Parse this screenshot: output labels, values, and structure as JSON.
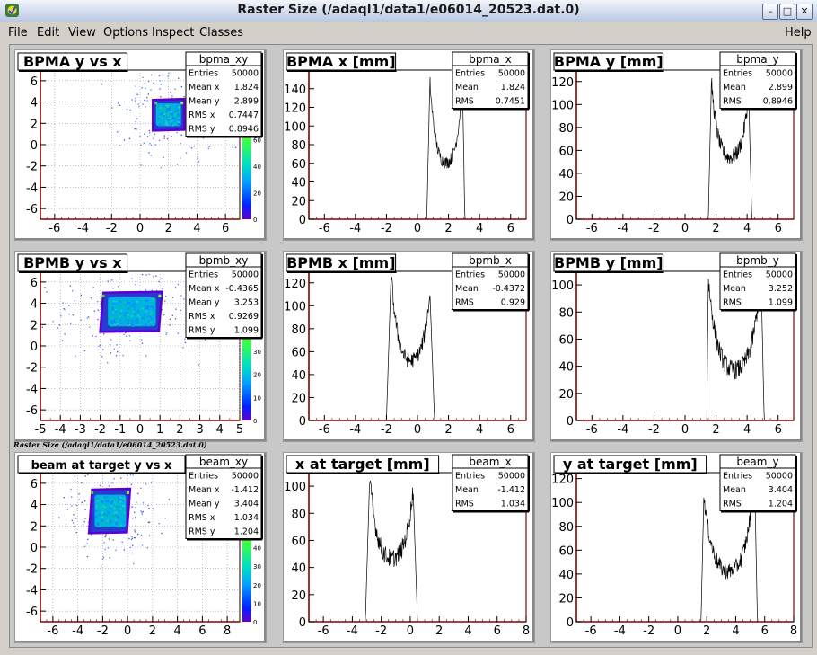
{
  "window": {
    "title": "Raster Size (/adaql1/data1/e06014_20523.dat.0)"
  },
  "menu": {
    "items": [
      "File",
      "Edit",
      "View",
      "Options",
      "Inspect",
      "Classes"
    ],
    "help": "Help"
  },
  "canvas_note": "Raster Size (/adaql1/data1/e06014_20523.dat.0)",
  "colors": {
    "titlebar": "#c3d0e8",
    "axis": "#8b0000",
    "line": "#000000",
    "background": "#d4d0c8"
  },
  "chart_data": [
    {
      "type": "heatmap",
      "title": "BPMA y vs x",
      "stats_name": "bpma_xy",
      "stats": [
        [
          "Entries",
          "50000"
        ],
        [
          "Mean x",
          "1.824"
        ],
        [
          "Mean y",
          "2.899"
        ],
        [
          "RMS x",
          "0.7447"
        ],
        [
          "RMS y",
          "0.8946"
        ]
      ],
      "xlim": [
        -7,
        7
      ],
      "ylim": [
        -7,
        7
      ],
      "xticks": [
        -6,
        -4,
        -2,
        0,
        2,
        4,
        6
      ],
      "yticks": [
        -6,
        -4,
        -2,
        0,
        2,
        4,
        6
      ],
      "core": {
        "x0": 0.9,
        "x1": 3.1,
        "y0": 1.4,
        "y1": 4.2,
        "skew": 0
      },
      "palette_ticks": [
        0,
        20,
        40,
        60
      ],
      "palette_max": 70
    },
    {
      "type": "line",
      "title": "BPMA x [mm]",
      "stats_name": "bpma_x",
      "stats": [
        [
          "Entries",
          "50000"
        ],
        [
          "Mean",
          "1.824"
        ],
        [
          "RMS",
          "0.7451"
        ]
      ],
      "xlim": [
        -7,
        7
      ],
      "ylim": [
        0,
        160
      ],
      "xticks": [
        -6,
        -4,
        -2,
        0,
        2,
        4,
        6
      ],
      "yticks": [
        0,
        20,
        40,
        60,
        80,
        100,
        120,
        140
      ],
      "shape": {
        "left": 0.8,
        "right": 2.9,
        "peakL": 148,
        "peakR": 148,
        "mid": 58,
        "leftStart": 0.6,
        "rightEnd": 3.05
      }
    },
    {
      "type": "line",
      "title": "BPMA y [mm]",
      "stats_name": "bpma_y",
      "stats": [
        [
          "Entries",
          "50000"
        ],
        [
          "Mean",
          "2.899"
        ],
        [
          "RMS",
          "0.8946"
        ]
      ],
      "xlim": [
        -7,
        7
      ],
      "ylim": [
        0,
        130
      ],
      "xticks": [
        -6,
        -4,
        -2,
        0,
        2,
        4,
        6
      ],
      "yticks": [
        0,
        20,
        40,
        60,
        80,
        100,
        120
      ],
      "shape": {
        "left": 1.7,
        "right": 4.1,
        "peakL": 120,
        "peakR": 110,
        "mid": 52,
        "leftStart": 1.5,
        "rightEnd": 4.3
      }
    },
    {
      "type": "heatmap",
      "title": "BPMB y vs x",
      "stats_name": "bpmb_xy",
      "stats": [
        [
          "Entries",
          "50000"
        ],
        [
          "Mean x",
          "-0.4365"
        ],
        [
          "Mean y",
          "3.253"
        ],
        [
          "RMS x",
          "0.9269"
        ],
        [
          "RMS y",
          "1.099"
        ]
      ],
      "xlim": [
        -5,
        5
      ],
      "ylim": [
        -7,
        7
      ],
      "xticks": [
        -5,
        -4,
        -3,
        -2,
        -1,
        0,
        1,
        2,
        3,
        4,
        5
      ],
      "yticks": [
        -6,
        -4,
        -2,
        0,
        2,
        4,
        6
      ],
      "core": {
        "x0": -2.0,
        "x1": 1.1,
        "y0": 1.4,
        "y1": 5.0,
        "skew": 0.35
      },
      "palette_ticks": [
        0,
        10,
        20,
        30
      ],
      "palette_max": 40
    },
    {
      "type": "line",
      "title": "BPMB x [mm]",
      "stats_name": "bpmb_x",
      "stats": [
        [
          "Entries",
          "50000"
        ],
        [
          "Mean",
          "-0.4372"
        ],
        [
          "RMS",
          "0.929"
        ]
      ],
      "xlim": [
        -7,
        7
      ],
      "ylim": [
        0,
        130
      ],
      "xticks": [
        -6,
        -4,
        -2,
        0,
        2,
        4,
        6
      ],
      "yticks": [
        0,
        20,
        40,
        60,
        80,
        100,
        120
      ],
      "shape": {
        "left": -1.7,
        "right": 0.8,
        "peakL": 128,
        "peakR": 112,
        "mid": 50,
        "leftStart": -2.0,
        "rightEnd": 1.1
      }
    },
    {
      "type": "line",
      "title": "BPMB y [mm]",
      "stats_name": "bpmb_y",
      "stats": [
        [
          "Entries",
          "50000"
        ],
        [
          "Mean",
          "3.252"
        ],
        [
          "RMS",
          "1.099"
        ]
      ],
      "xlim": [
        -7,
        7
      ],
      "ylim": [
        0,
        110
      ],
      "xticks": [
        -6,
        -4,
        -2,
        0,
        2,
        4,
        6
      ],
      "yticks": [
        0,
        20,
        40,
        60,
        80,
        100
      ],
      "shape": {
        "left": 1.5,
        "right": 4.9,
        "peakL": 104,
        "peakR": 108,
        "mid": 35,
        "leftStart": 1.4,
        "rightEnd": 5.1
      }
    },
    {
      "type": "heatmap",
      "title": "beam at target y vs x",
      "stats_name": "beam_xy",
      "stats": [
        [
          "Entries",
          "50000"
        ],
        [
          "Mean x",
          "-1.412"
        ],
        [
          "Mean y",
          "3.404"
        ],
        [
          "RMS x",
          "1.034"
        ],
        [
          "RMS y",
          "1.204"
        ]
      ],
      "xlim": [
        -7,
        9
      ],
      "ylim": [
        -7,
        7
      ],
      "xticks": [
        -6,
        -4,
        -2,
        0,
        2,
        4,
        6,
        8
      ],
      "yticks": [
        -6,
        -4,
        -2,
        0,
        2,
        4,
        6
      ],
      "core": {
        "x0": -3.1,
        "x1": 0.2,
        "y0": 1.4,
        "y1": 5.4,
        "skew": 0.35
      },
      "palette_ticks": [
        0,
        10,
        20,
        30,
        40
      ],
      "palette_max": 50
    },
    {
      "type": "line",
      "title": "x at target [mm]",
      "stats_name": "beam_x",
      "stats": [
        [
          "Entries",
          "50000"
        ],
        [
          "Mean",
          "-1.412"
        ],
        [
          "RMS",
          "1.034"
        ]
      ],
      "xlim": [
        -7,
        8
      ],
      "ylim": [
        0,
        110
      ],
      "xticks": [
        -6,
        -4,
        -2,
        0,
        2,
        4,
        6,
        8
      ],
      "yticks": [
        0,
        20,
        40,
        60,
        80,
        100
      ],
      "shape": {
        "left": -2.8,
        "right": 0.2,
        "peakL": 106,
        "peakR": 98,
        "mid": 45,
        "leftStart": -3.1,
        "rightEnd": 0.5
      }
    },
    {
      "type": "line",
      "title": "y at target [mm]",
      "stats_name": "beam_y",
      "stats": [
        [
          "Entries",
          "50000"
        ],
        [
          "Mean",
          "3.404"
        ],
        [
          "RMS",
          "1.204"
        ]
      ],
      "xlim": [
        -7,
        8
      ],
      "ylim": [
        0,
        125
      ],
      "xticks": [
        -6,
        -4,
        -2,
        0,
        2,
        4,
        6,
        8
      ],
      "yticks": [
        0,
        20,
        40,
        60,
        80,
        100,
        120
      ],
      "shape": {
        "left": 1.8,
        "right": 5.3,
        "peakL": 105,
        "peakR": 122,
        "mid": 40,
        "leftStart": 1.6,
        "rightEnd": 5.5
      }
    }
  ]
}
